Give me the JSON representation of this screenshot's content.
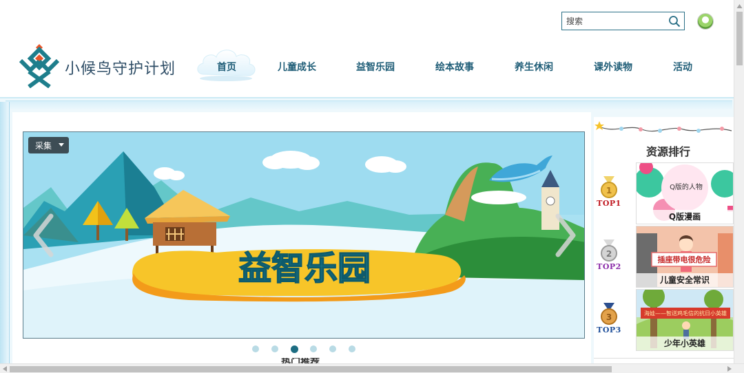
{
  "header": {
    "brand": "小候鸟守护计划",
    "search_placeholder": "搜索",
    "nav": [
      "首页",
      "儿童成长",
      "益智乐园",
      "绘本故事",
      "养生休闲",
      "课外读物",
      "活动"
    ],
    "nav_active_index": 0
  },
  "carousel": {
    "collect_label": "采集",
    "banner_text": "益智乐园",
    "slide_count": 6,
    "active_slide": 3
  },
  "main": {
    "next_section_title": "热门推荐"
  },
  "sidebar": {
    "title": "资源排行",
    "items": [
      {
        "rank": "TOP1",
        "caption": "Q版漫画",
        "thumb_text": "Q版的人物"
      },
      {
        "rank": "TOP2",
        "caption": "儿童安全常识",
        "thumb_text": "插座带电很危险"
      },
      {
        "rank": "TOP3",
        "caption": "少年小英雄",
        "thumb_text": "海娃——智送鸡毛信的抗日小英雄"
      }
    ]
  },
  "colors": {
    "accent": "#1f5d77",
    "logo_orange": "#e8562a",
    "logo_teal": "#1e7e8c",
    "top1": "#c0161f",
    "top2": "#8a2aa8",
    "top3": "#1e4f9a"
  }
}
